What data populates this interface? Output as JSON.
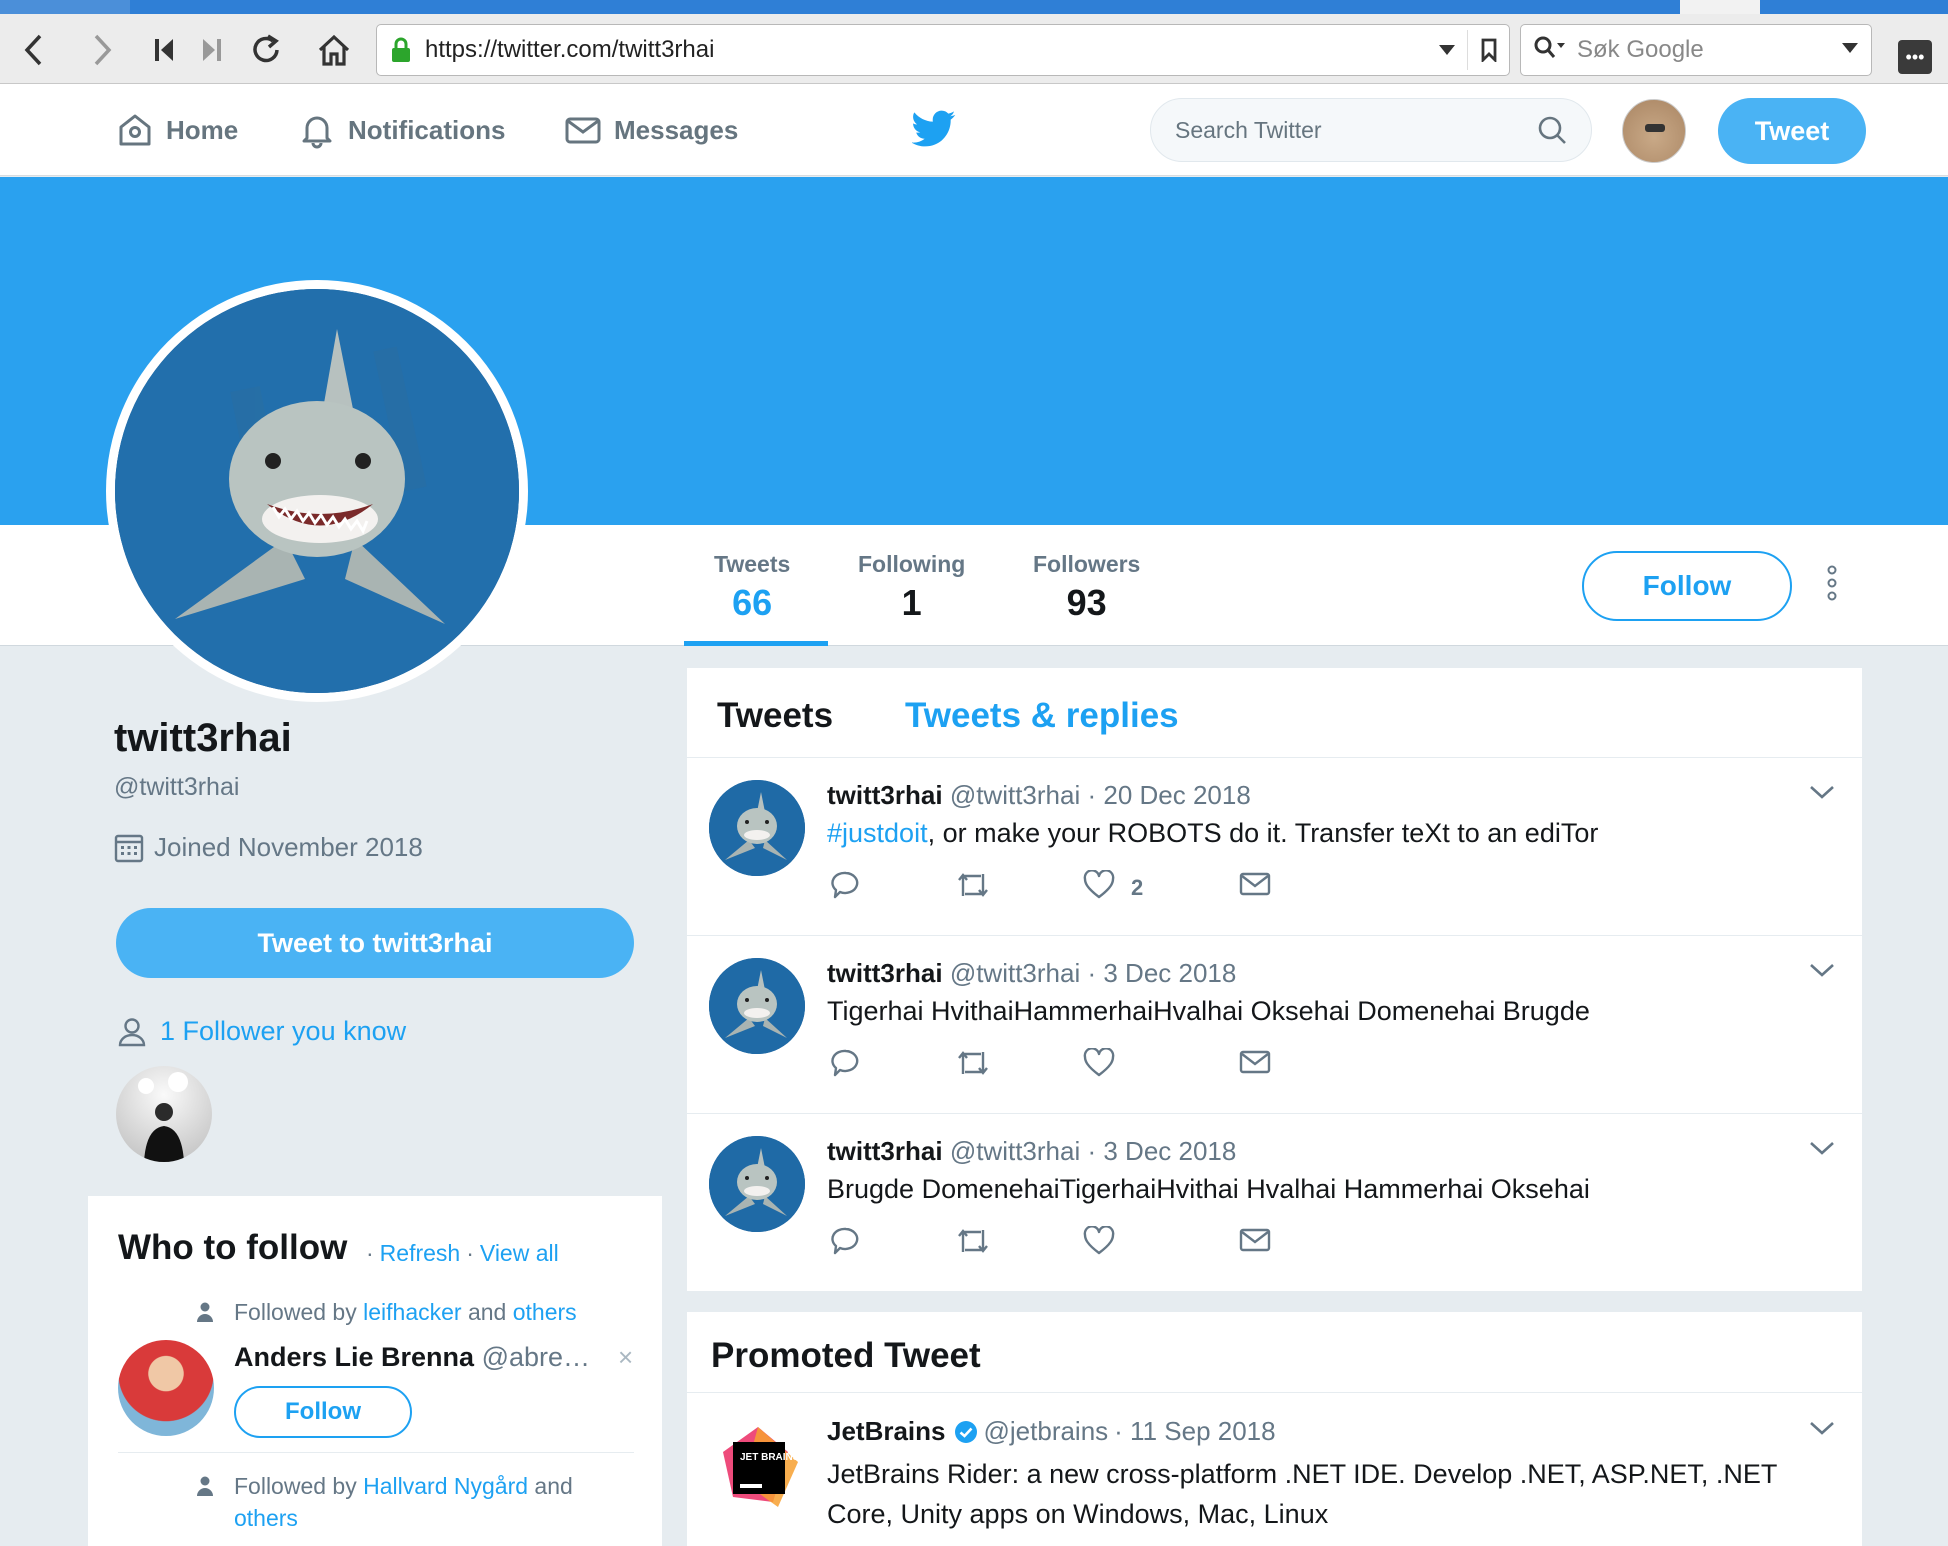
{
  "browser": {
    "url": "https://twitter.com/twitt3rhai",
    "search_placeholder": "Søk Google",
    "ext_icon": "•••"
  },
  "header": {
    "nav": [
      {
        "label": "Home"
      },
      {
        "label": "Notifications"
      },
      {
        "label": "Messages"
      }
    ],
    "search_placeholder": "Search Twitter",
    "tweet_button": "Tweet"
  },
  "profile": {
    "name": "twitt3rhai",
    "handle": "@twitt3rhai",
    "joined": "Joined November 2018",
    "tweet_to": "Tweet to twitt3rhai",
    "followers_you_know": "1 Follower you know",
    "stats": [
      {
        "label": "Tweets",
        "value": "66"
      },
      {
        "label": "Following",
        "value": "1"
      },
      {
        "label": "Followers",
        "value": "93"
      }
    ],
    "follow_button": "Follow"
  },
  "who_to_follow": {
    "title": "Who to follow",
    "sep": "·",
    "refresh": "Refresh",
    "view_all": "View all",
    "suggestions": [
      {
        "followed_by_prefix": "Followed by",
        "followed_by_user": "leifhacker",
        "and": "and",
        "others": "others",
        "name": "Anders Lie Brenna",
        "handle": "@abre…",
        "close": "×",
        "follow": "Follow"
      },
      {
        "followed_by_prefix": "Followed by",
        "followed_by_user": "Hallvard Nygård",
        "and": "and",
        "others": "others"
      }
    ]
  },
  "timeline": {
    "tabs": [
      {
        "label": "Tweets"
      },
      {
        "label": "Tweets & replies"
      }
    ],
    "tweets": [
      {
        "name": "twitt3rhai",
        "handle": "@twitt3rhai",
        "date": "· 20 Dec 2018",
        "hashtag": "#justdoit",
        "text": ", or make your ROBOTS do it. Transfer teXt to an ediTor",
        "likes": "2"
      },
      {
        "name": "twitt3rhai",
        "handle": "@twitt3rhai",
        "date": "· 3 Dec 2018",
        "hashtag": "",
        "text": "Tigerhai HvithaiHammerhaiHvalhai Oksehai Domenehai Brugde",
        "likes": ""
      },
      {
        "name": "twitt3rhai",
        "handle": "@twitt3rhai",
        "date": "· 3 Dec 2018",
        "hashtag": "",
        "text": "Brugde DomenehaiTigerhaiHvithai Hvalhai Hammerhai Oksehai",
        "likes": ""
      }
    ]
  },
  "promoted": {
    "title": "Promoted Tweet",
    "name": "JetBrains",
    "handle": "@jetbrains",
    "date": "· 11 Sep 2018",
    "logo_text": "JET BRAINS",
    "text": "JetBrains Rider: a new cross-platform .NET IDE. Develop .NET, ASP.NET, .NET Core, Unity apps on Windows, Mac, Linux"
  },
  "colors": {
    "twitter_blue": "#1da1f2",
    "banner": "#2aa1ef",
    "button_blue": "#4ab3f4"
  }
}
